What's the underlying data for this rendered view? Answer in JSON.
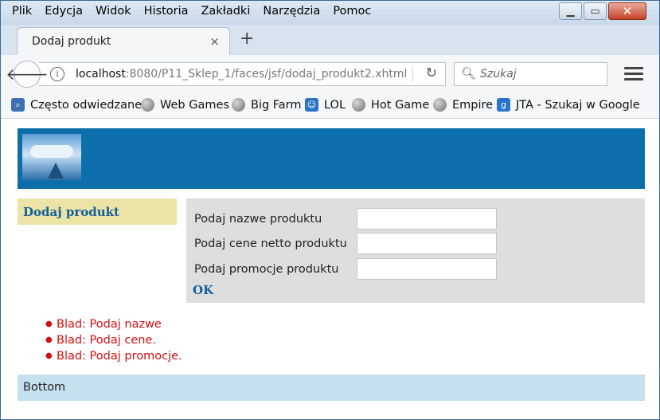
{
  "menu": [
    "Plik",
    "Edycja",
    "Widok",
    "Historia",
    "Zakładki",
    "Narzędzia",
    "Pomoc"
  ],
  "tab": {
    "title": "Dodaj produkt",
    "close": "×",
    "new": "+"
  },
  "nav": {
    "url_host": "localhost",
    "url_rest": ":8080/P11_Sklep_1/faces/jsf/dodaj_produkt2.xhtml",
    "search_placeholder": "Szukaj"
  },
  "bookmarks": [
    {
      "label": "Często odwiedzane",
      "icon": "most-visited-icon"
    },
    {
      "label": "Web Games",
      "icon": "globe-icon"
    },
    {
      "label": "Big Farm",
      "icon": "globe-icon"
    },
    {
      "label": "LOL",
      "icon": "lol-icon"
    },
    {
      "label": "Hot Game",
      "icon": "globe-icon"
    },
    {
      "label": "Empire",
      "icon": "globe-icon"
    },
    {
      "label": "JTA - Szukaj w Google",
      "icon": "google-icon"
    }
  ],
  "page": {
    "sidebar_link": "Dodaj produkt",
    "form": {
      "name_label": "Podaj nazwe produktu",
      "name_value": "",
      "price_label": "Podaj cene netto produktu",
      "price_value": "",
      "promo_label": "Podaj promocje produktu",
      "promo_value": "",
      "ok": "OK"
    },
    "errors": [
      "Blad: Podaj nazwe",
      "Blad: Podaj cene.",
      "Blad: Podaj promocje."
    ],
    "footer": "Bottom"
  },
  "colors": {
    "header": "#0c6fab",
    "sidebar": "#ece3a6",
    "form_bg": "#dedede",
    "error": "#d21010",
    "footer": "#c5e0ee"
  }
}
